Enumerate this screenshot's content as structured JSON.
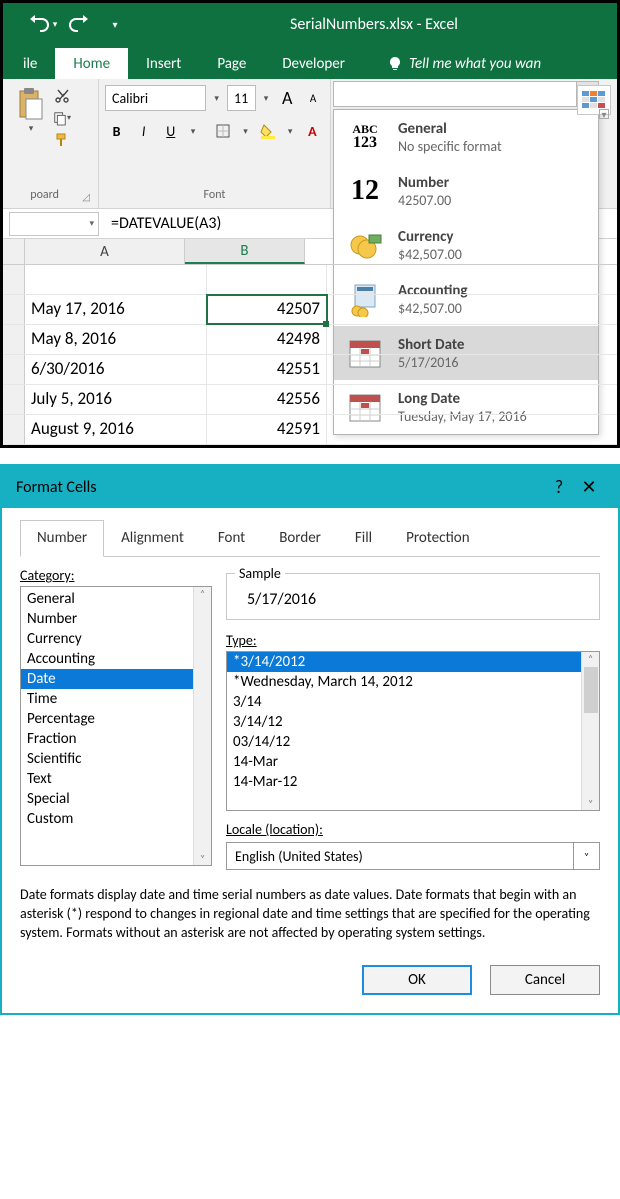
{
  "title": "SerialNumbers.xlsx - Excel",
  "ribbon": {
    "file": "ile",
    "tabs": [
      "Home",
      "Insert",
      "Page",
      "Developer"
    ],
    "active_tab": "Home",
    "tellme": "Tell me what you wan"
  },
  "clipboard": {
    "label": "poard"
  },
  "font": {
    "name": "Calibri",
    "size": "11",
    "label": "Font",
    "bold": "B",
    "italic": "I",
    "underline": "U",
    "grow": "A",
    "shrink": "A"
  },
  "number_format": {
    "items": [
      {
        "title": "General",
        "sample": "No specific format"
      },
      {
        "title": "Number",
        "sample": "42507.00"
      },
      {
        "title": "Currency",
        "sample": "$42,507.00"
      },
      {
        "title": "Accounting",
        "sample": " $42,507.00"
      },
      {
        "title": "Short Date",
        "sample": "5/17/2016"
      },
      {
        "title": "Long Date",
        "sample": "Tuesday, May 17, 2016"
      }
    ],
    "selected_index": 4
  },
  "formula_bar": {
    "formula": "=DATEVALUE(A3)"
  },
  "columns": [
    "A",
    "B"
  ],
  "cells": [
    {
      "a": "",
      "b": ""
    },
    {
      "a": "May 17, 2016",
      "b": "42507"
    },
    {
      "a": "May 8, 2016",
      "b": "42498"
    },
    {
      "a": "6/30/2016",
      "b": "42551"
    },
    {
      "a": "July 5, 2016",
      "b": "42556"
    },
    {
      "a": "August 9, 2016",
      "b": "42591"
    }
  ],
  "active_cell_row": 1,
  "dialog": {
    "title": "Format Cells",
    "tabs": [
      "Number",
      "Alignment",
      "Font",
      "Border",
      "Fill",
      "Protection"
    ],
    "active_tab": "Number",
    "category_label": "Category:",
    "categories": [
      "General",
      "Number",
      "Currency",
      "Accounting",
      "Date",
      "Time",
      "Percentage",
      "Fraction",
      "Scientific",
      "Text",
      "Special",
      "Custom"
    ],
    "selected_category": "Date",
    "sample_label": "Sample",
    "sample_value": "5/17/2016",
    "type_label": "Type:",
    "types": [
      "*3/14/2012",
      "*Wednesday, March 14, 2012",
      "3/14",
      "3/14/12",
      "03/14/12",
      "14-Mar",
      "14-Mar-12"
    ],
    "selected_type": "*3/14/2012",
    "locale_label": "Locale (location):",
    "locale_value": "English (United States)",
    "description": "Date formats display date and time serial numbers as date values.  Date formats that begin with an asterisk (*) respond to changes in regional date and time settings that are specified for the operating system.  Formats without an asterisk are not affected by operating system settings.",
    "ok": "OK",
    "cancel": "Cancel"
  }
}
